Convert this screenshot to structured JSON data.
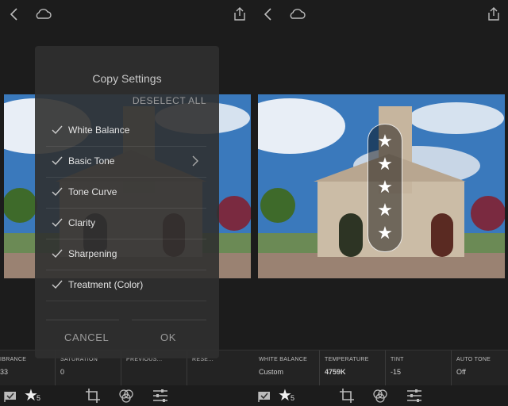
{
  "left": {
    "bottom_cells": [
      {
        "label": "IBRANCE",
        "value": "33"
      },
      {
        "label": "SATURATION",
        "value": "0"
      },
      {
        "label": "PREVIOUS...",
        "value": ""
      },
      {
        "label": "RESE...",
        "value": ""
      }
    ],
    "rating_count": "5"
  },
  "dialog": {
    "title": "Copy Settings",
    "deselect_all": "DESELECT ALL",
    "options": [
      {
        "label": "White Balance",
        "checked": true
      },
      {
        "label": "Basic Tone",
        "checked": true,
        "has_submenu": true
      },
      {
        "label": "Tone Curve",
        "checked": true
      },
      {
        "label": "Clarity",
        "checked": true
      },
      {
        "label": "Sharpening",
        "checked": true
      },
      {
        "label": "Treatment (Color)",
        "checked": true
      }
    ],
    "cancel": "CANCEL",
    "ok": "OK"
  },
  "right": {
    "bottom_cells": [
      {
        "label": "WHITE BALANCE",
        "value": "Custom"
      },
      {
        "label": "TEMPERATURE",
        "value": "4759K"
      },
      {
        "label": "TINT",
        "value": "-15"
      },
      {
        "label": "AUTO TONE",
        "value": "Off"
      }
    ],
    "rating_count": "5",
    "stars": 5
  },
  "colors": {
    "background": "#1c1c1c",
    "dialog": "#303030",
    "text": "#e4e4e4"
  }
}
